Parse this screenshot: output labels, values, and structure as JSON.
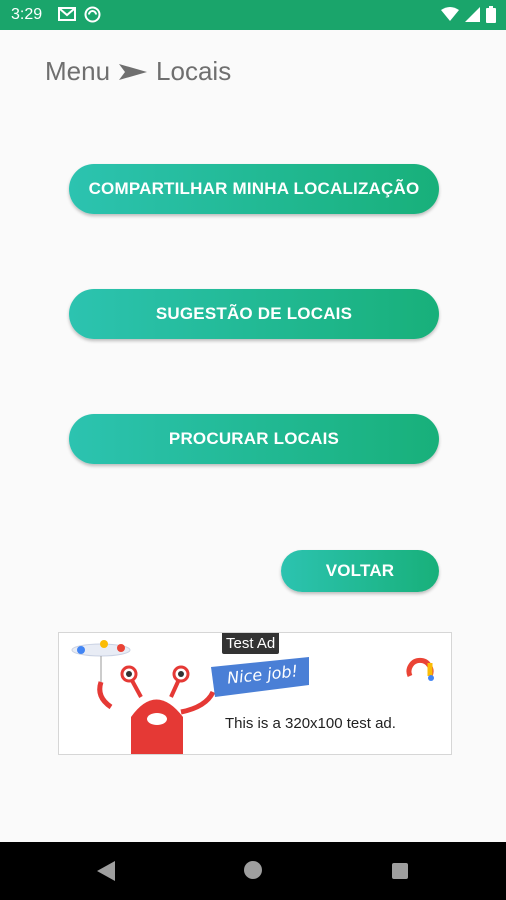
{
  "status_bar": {
    "time": "3:29",
    "icons_left": [
      "gmail-icon",
      "sync-icon"
    ],
    "icons_right": [
      "wifi-icon",
      "signal-icon",
      "battery-icon"
    ]
  },
  "breadcrumb": {
    "parent": "Menu",
    "separator_icon": "arrow-right-icon",
    "current": "Locais"
  },
  "buttons": {
    "share_location": "COMPARTILHAR MINHA LOCALIZAÇÃO",
    "suggest_places": "SUGESTÃO DE LOCAIS",
    "search_places": "PROCURAR LOCAIS",
    "back": "VOLTAR"
  },
  "ad": {
    "badge": "Test Ad",
    "flag_text": "Nice job!",
    "body": "This is a 320x100 test ad."
  },
  "colors": {
    "status_bar": "#1aa56b",
    "button_gradient_start": "#2cc3b0",
    "button_gradient_end": "#18b07a",
    "background": "#fafafa"
  },
  "nav_bar": {
    "icons": [
      "back-icon",
      "home-icon",
      "recents-icon"
    ]
  }
}
